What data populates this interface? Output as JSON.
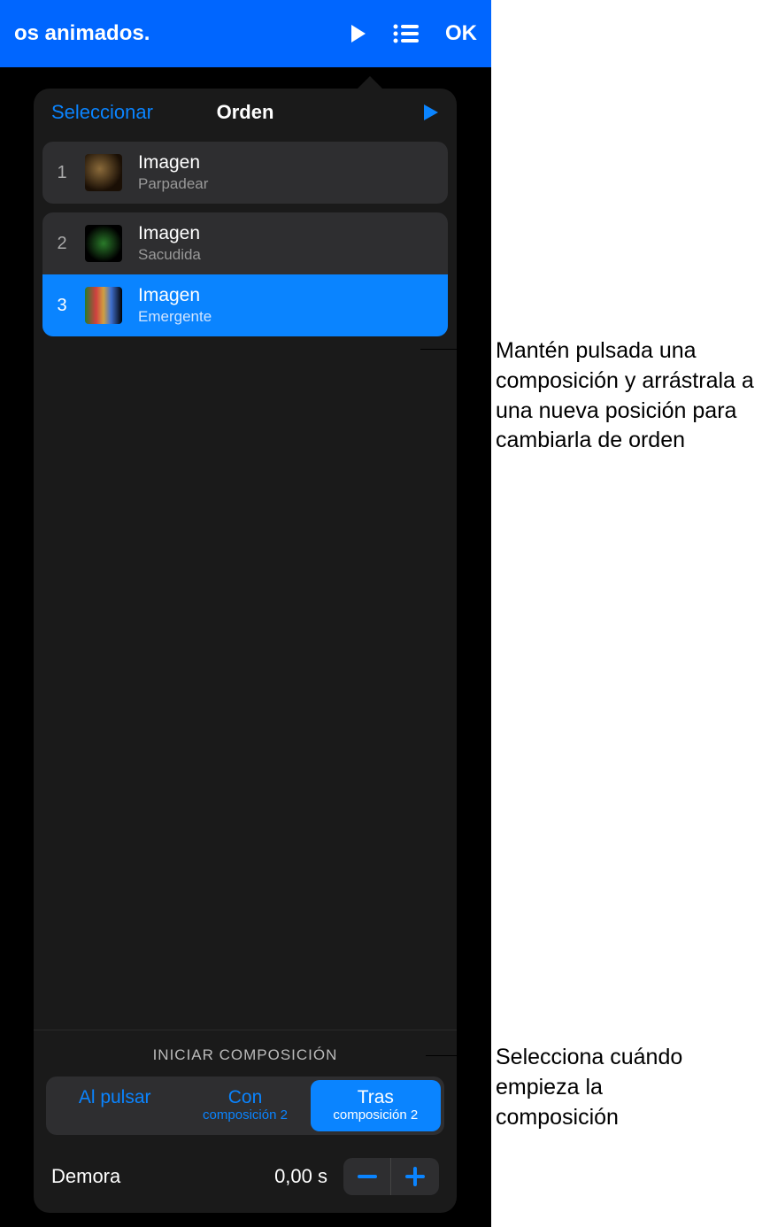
{
  "nav": {
    "title": "os animados.",
    "ok": "OK"
  },
  "popover": {
    "select": "Seleccionar",
    "title": "Orden"
  },
  "builds": [
    {
      "num": "1",
      "name": "Imagen",
      "effect": "Parpadear",
      "selected": false,
      "grouped": false
    },
    {
      "num": "2",
      "name": "Imagen",
      "effect": "Sacudida",
      "selected": false,
      "grouped": true
    },
    {
      "num": "3",
      "name": "Imagen",
      "effect": "Emergente",
      "selected": true,
      "grouped": true
    }
  ],
  "footer": {
    "title": "INICIAR COMPOSICIÓN",
    "segments": [
      {
        "main": "Al pulsar",
        "sub": "",
        "active": false
      },
      {
        "main": "Con",
        "sub": "composición 2",
        "active": false
      },
      {
        "main": "Tras",
        "sub": "composición 2",
        "active": true
      }
    ],
    "delay_label": "Demora",
    "delay_value": "0,00  s"
  },
  "callouts": {
    "drag": "Mantén pulsada una composición y arrástrala a una nueva posición para cambiarla de orden",
    "start": "Selecciona cuándo empieza la composición"
  }
}
